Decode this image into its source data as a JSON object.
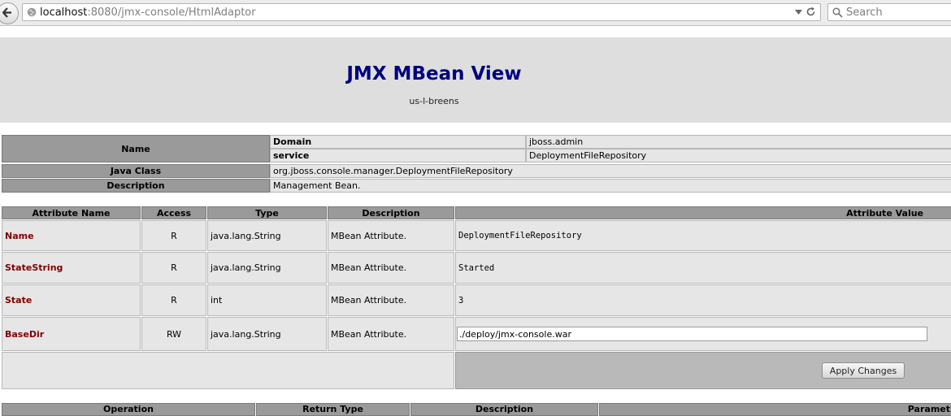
{
  "browser": {
    "url_host": "localhost",
    "url_path": ":8080/jmx-console/HtmlAdaptor",
    "search_placeholder": "Search"
  },
  "page": {
    "title": "JMX MBean View",
    "subtitle": "us-l-breens"
  },
  "mbean_info": {
    "name_label": "Name",
    "domain_label": "Domain",
    "domain_value": "jboss.admin",
    "service_label": "service",
    "service_value": "DeploymentFileRepository",
    "java_class_label": "Java Class",
    "java_class_value": "org.jboss.console.manager.DeploymentFileRepository",
    "description_label": "Description",
    "description_value": "Management Bean."
  },
  "attributes": {
    "headers": [
      "Attribute Name",
      "Access",
      "Type",
      "Description",
      "Attribute Value"
    ],
    "rows": [
      {
        "name": "Name",
        "access": "R",
        "type": "java.lang.String",
        "description": "MBean Attribute.",
        "value": "DeploymentFileRepository"
      },
      {
        "name": "StateString",
        "access": "R",
        "type": "java.lang.String",
        "description": "MBean Attribute.",
        "value": "Started"
      },
      {
        "name": "State",
        "access": "R",
        "type": "int",
        "description": "MBean Attribute.",
        "value": "3"
      },
      {
        "name": "BaseDir",
        "access": "RW",
        "type": "java.lang.String",
        "description": "MBean Attribute.",
        "value": "./deploy/jmx-console.war"
      }
    ],
    "apply_label": "Apply Changes"
  },
  "operations": {
    "headers": [
      "Operation",
      "Return Type",
      "Description",
      "Paramet"
    ]
  }
}
